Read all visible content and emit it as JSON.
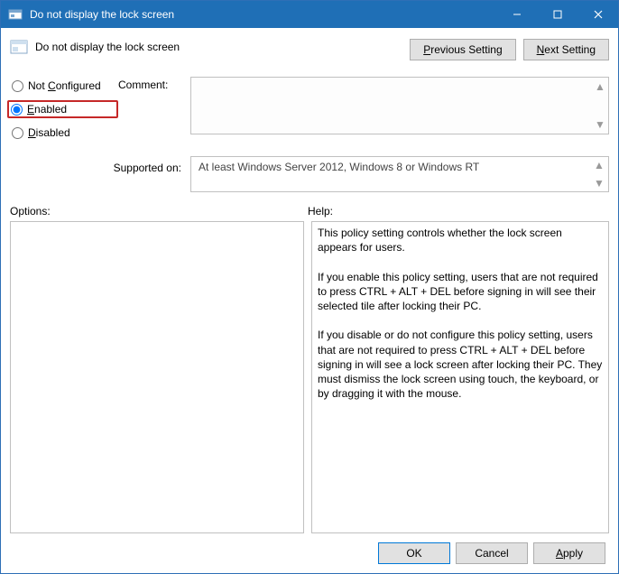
{
  "window": {
    "title": "Do not display the lock screen"
  },
  "header": {
    "policy_name": "Do not display the lock screen"
  },
  "nav": {
    "previous_prefix": "P",
    "previous_rest": "revious Setting",
    "next_prefix": "N",
    "next_rest": "ext Setting"
  },
  "state": {
    "not_configured_prefix": "C",
    "not_configured_label": "Not ",
    "not_configured_rest": "onfigured",
    "enabled_prefix": "E",
    "enabled_rest": "nabled",
    "disabled_prefix": "D",
    "disabled_rest": "isabled",
    "selected": "enabled"
  },
  "comment": {
    "label": "Comment:",
    "value": ""
  },
  "supported": {
    "label": "Supported on:",
    "text": "At least Windows Server 2012, Windows 8 or Windows RT"
  },
  "panes": {
    "options_label": "Options:",
    "help_label": "Help:",
    "options_text": "",
    "help_text": "This policy setting controls whether the lock screen appears for users.\n\nIf you enable this policy setting, users that are not required to press CTRL + ALT + DEL before signing in will see their selected tile after locking their PC.\n\nIf you disable or do not configure this policy setting, users that are not required to press CTRL + ALT + DEL before signing in will see a lock screen after locking their PC. They must dismiss the lock screen using touch, the keyboard, or by dragging it with the mouse."
  },
  "footer": {
    "ok": "OK",
    "cancel": "Cancel",
    "apply_prefix": "A",
    "apply_rest": "pply"
  }
}
